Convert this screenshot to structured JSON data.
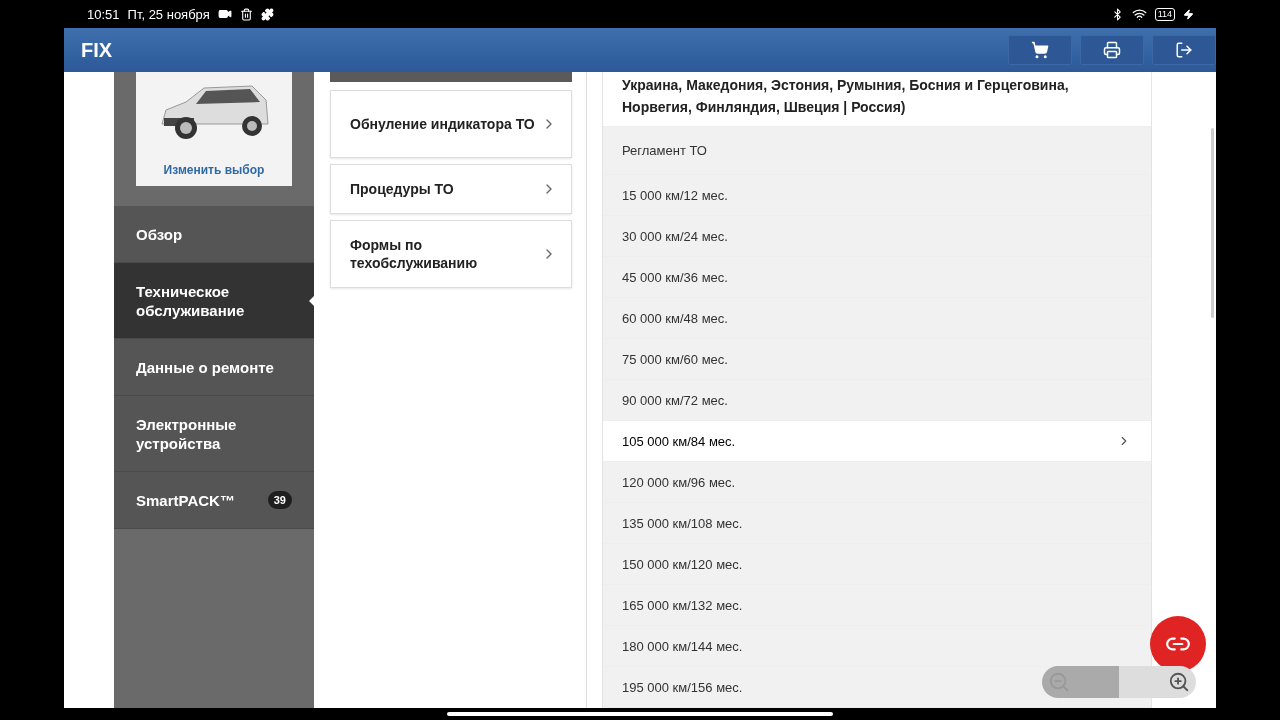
{
  "status_bar": {
    "time": "10:51",
    "date": "Пт, 25 ноября",
    "battery": "114"
  },
  "app": {
    "logo": "FIX"
  },
  "vehicle": {
    "change_link": "Изменить выбор"
  },
  "sidebar": {
    "items": [
      {
        "label": "Обзор",
        "selected": false
      },
      {
        "label": "Техническое обслуживание",
        "selected": true
      },
      {
        "label": "Данные о ремонте",
        "selected": false
      },
      {
        "label": "Электронные устройства",
        "selected": false
      },
      {
        "label": "SmartPACK™",
        "selected": false,
        "badge": "39"
      }
    ]
  },
  "menu": {
    "items": [
      "Обнуление индикатора ТО",
      "Процедуры ТО",
      "Формы по техобслуживанию"
    ]
  },
  "schedule": {
    "heading": "Украина, Македония, Эстония, Румыния, Босния и Герцеговина, Норвегия, Финляндия, Швеция | Россия)",
    "section": "Регламент ТО",
    "rows": [
      {
        "label": "15 000 км/12 мес.",
        "selected": false
      },
      {
        "label": "30 000 км/24 мес.",
        "selected": false
      },
      {
        "label": "45 000 км/36 мес.",
        "selected": false
      },
      {
        "label": "60 000 км/48 мес.",
        "selected": false
      },
      {
        "label": "75 000 км/60 мес.",
        "selected": false
      },
      {
        "label": "90 000 км/72 мес.",
        "selected": false
      },
      {
        "label": "105 000 км/84 мес.",
        "selected": true
      },
      {
        "label": "120 000 км/96 мес.",
        "selected": false
      },
      {
        "label": "135 000 км/108 мес.",
        "selected": false
      },
      {
        "label": "150 000 км/120 мес.",
        "selected": false
      },
      {
        "label": "165 000 км/132 мес.",
        "selected": false
      },
      {
        "label": "180 000 км/144 мес.",
        "selected": false
      },
      {
        "label": "195 000 км/156 мес.",
        "selected": false
      }
    ]
  }
}
